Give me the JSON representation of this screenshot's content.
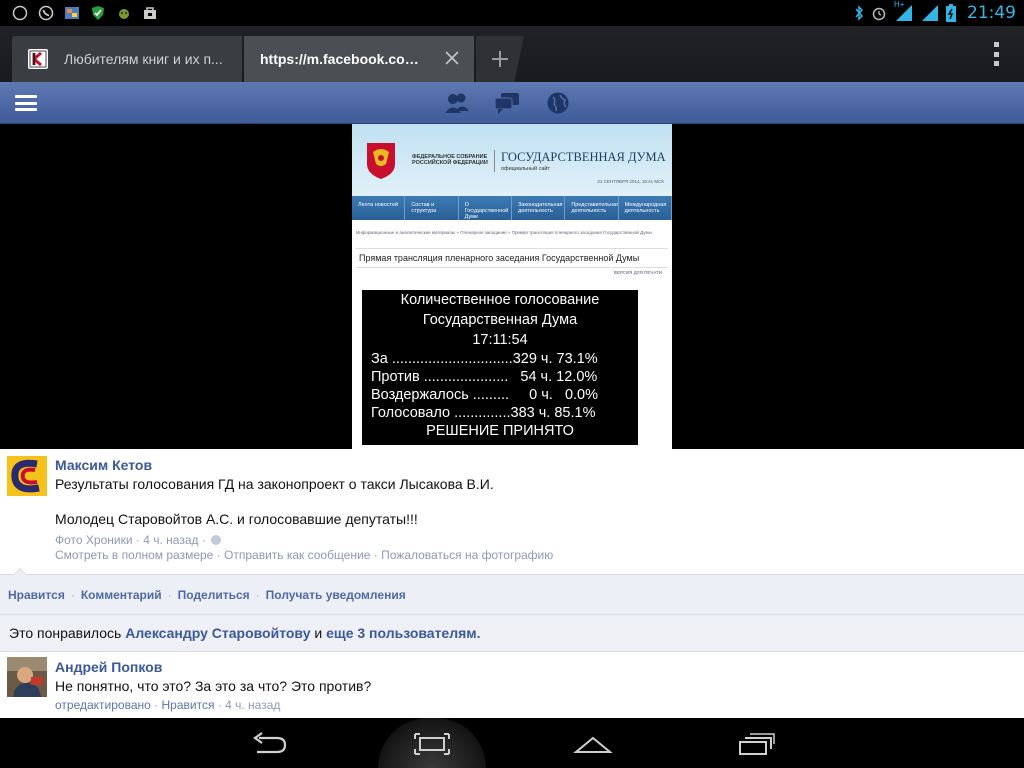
{
  "status": {
    "time": "21:49",
    "network_type": "H+"
  },
  "tabs": [
    {
      "title": "Любителям книг и их п...",
      "active": false
    },
    {
      "title": "https://m.facebook.com...",
      "active": true
    }
  ],
  "photo": {
    "duma_small_text": "ФЕДЕРАЛЬНОЕ СОБРАНИЕ РОССИЙСКОЙ ФЕДЕРАЦИИ",
    "duma_title": "ГОСУДАРСТВЕННАЯ ДУМА",
    "duma_subtitle": "официальный сайт",
    "duma_date": "21 СЕНТЯБРЯ 2014, 16:41 МСК",
    "duma_nav": [
      "Лента новостей",
      "Состав и структура",
      "О Государственной Думе",
      "Законодательная деятельность",
      "Представительная деятельность",
      "Международная деятельность"
    ],
    "duma_crumbs": "Информационные и аналитические материалы  »  Пленарное заседание  »  Прямая трансляция пленарного заседания Государственной Думы",
    "duma_page_title": "Прямая трансляция пленарного заседания Государственной Думы",
    "duma_print": "ВЕРСИЯ ДЛЯ ПЕЧАТИ",
    "board": {
      "line1": "Количественное голосование",
      "line2": "Государственная Дума",
      "time": "17:11:54",
      "rows": [
        "За ..............................329 ч. 73.1%",
        "Против .....................   54 ч. 12.0%",
        "Воздержалось .........     0 ч.   0.0%",
        "Голосовало ..............383 ч. 85.1%"
      ],
      "result": "РЕШЕНИЕ ПРИНЯТО"
    }
  },
  "post": {
    "author": "Максим Кетов",
    "text1": "Результаты голосования ГД на законопроект о такси Лысакова В.И.",
    "text2": "Молодец Старовойтов А.С. и голосовавшие депутаты!!!",
    "album": "Фото Хроники",
    "time": "4 ч. назад",
    "link_full": "Смотреть в полном размере",
    "link_send": "Отправить как сообщение",
    "link_report": "Пожаловаться на фотографию"
  },
  "actions": {
    "like": "Нравится",
    "comment": "Комментарий",
    "share": "Поделиться",
    "notify": "Получать уведомления"
  },
  "likes": {
    "prefix": "Это понравилось",
    "name": "Александру Старовойтову",
    "and": "и",
    "others": "еще 3 пользователям."
  },
  "comment": {
    "author": "Андрей Попков",
    "text": "Не понятно, что это? За это за что? Это против?",
    "edited": "отредактировано",
    "like": "Нравится",
    "time": "4 ч. назад"
  },
  "colors": {
    "fb_blue": "#3b5998",
    "status_accent": "#33b5e5"
  }
}
